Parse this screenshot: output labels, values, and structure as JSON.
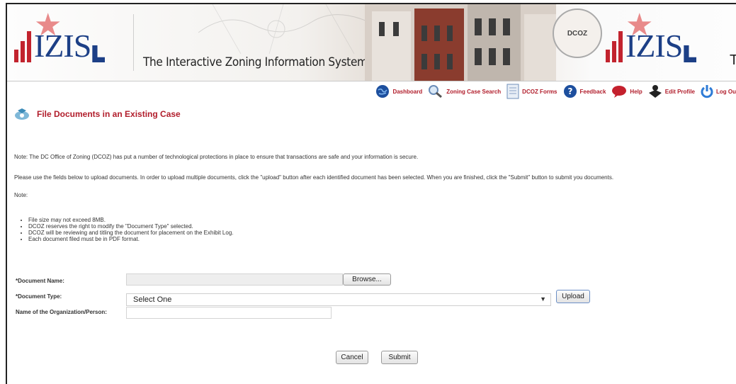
{
  "banner": {
    "logo_text": "IZIS",
    "tagline": "The Interactive Zoning Information System",
    "tagline_repeat": "Th",
    "seal_text": "DCOZ"
  },
  "nav": [
    {
      "label": "Dashboard",
      "icon": "globe-icon"
    },
    {
      "label": "Zoning Case Search",
      "icon": "magnifier-icon"
    },
    {
      "label": "DCOZ Forms",
      "icon": "document-icon"
    },
    {
      "label": "Feedback",
      "icon": "question-icon"
    },
    {
      "label": "Help",
      "icon": "speech-bubble-icon"
    },
    {
      "label": "Edit Profile",
      "icon": "person-icon"
    },
    {
      "label": "Log Ou",
      "icon": "power-icon"
    }
  ],
  "page": {
    "title": "File Documents in an Existing Case",
    "security_note": "Note: The DC Office of Zoning (DCOZ) has put a number of technological protections in place to ensure that transactions are safe and your information is secure.",
    "instructions": "Please use the fields below to upload documents. In order to upload multiple documents, click the \"upload\" button after each identified document has been selected. When you are finished, click the \"Submit\" button to submit you documents.",
    "note_label": "Note:",
    "notes": [
      "File size may not exceed 8MB.",
      "DCOZ reserves the right to modify the \"Document Type\" selected.",
      "DCOZ will be reviewing and titling the document for placement on the Exhibit Log.",
      "Each document filed must be in PDF format."
    ]
  },
  "form": {
    "doc_name_label": "*Document Name:",
    "doc_name_value": "",
    "browse_label": "Browse...",
    "doc_type_label": "*Document Type:",
    "doc_type_selected": "Select One",
    "upload_label": "Upload",
    "org_label": "Name of the Organization/Person:",
    "org_value": "",
    "cancel_label": "Cancel",
    "submit_label": "Submit"
  },
  "colors": {
    "accent_red": "#b11d2b",
    "logo_blue": "#1c3f86"
  }
}
